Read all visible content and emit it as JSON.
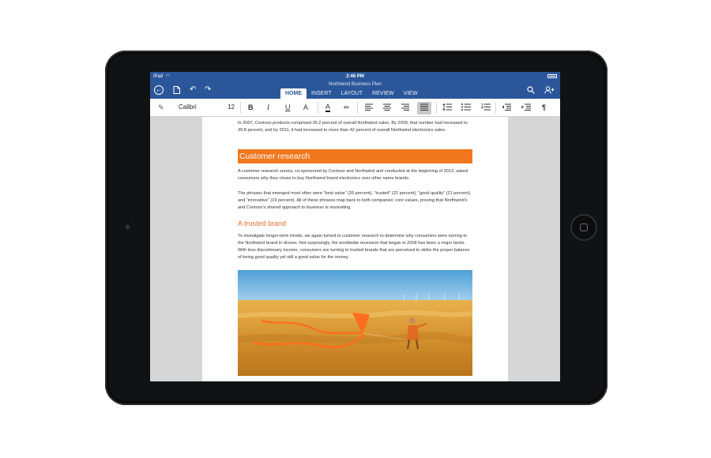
{
  "status_bar": {
    "carrier": "iPad",
    "time": "2:46 PM"
  },
  "title_bar": {
    "document_title": "Northwind Business Plan",
    "tabs": [
      {
        "label": "HOME",
        "active": true
      },
      {
        "label": "INSERT",
        "active": false
      },
      {
        "label": "LAYOUT",
        "active": false
      },
      {
        "label": "REVIEW",
        "active": false
      },
      {
        "label": "VIEW",
        "active": false
      }
    ],
    "icons": [
      "back-icon",
      "document-icon",
      "undo-icon",
      "redo-icon",
      "search-icon",
      "share-person-icon"
    ]
  },
  "toolbar": {
    "font_name": "Calibri",
    "font_size": "12",
    "bold_label": "B",
    "italic_label": "I",
    "underline_label": "U",
    "text_effects_label": "A",
    "font_color_label": "A",
    "paragraph_mark_label": "¶"
  },
  "document": {
    "para_intro": "In 2007, Contoso products comprised 35.2 percent of overall Northwind sales. By 2009, that number had increased to 39.8 percent, and by 2011, it had increased to more than 42 percent of overall Northwind electronics sales.",
    "heading_research": "Customer research",
    "para_survey": "A customer research survey, co-sponsored by Contoso and Northwind and conducted at the beginning of 2013, asked consumers why they chose to buy Northwind brand electronics over other name brands.",
    "para_phrases": "The phrases that emerged most often were “best value” (26 percent), “trusted” (22 percent), “good quality” (21 percent), and “innovative” (19 percent). All of these phrases map back to both companies’ core values, proving that Northwind’s and Contoso’s shared approach to business is resonating.",
    "heading_trusted": "A trusted brand",
    "para_trends": "To investigate longer-term trends, we again turned to customer research to determine why consumers were turning to the Northwind brand in droves. Not surprisingly, the worldwide recession that began in 2008 has been a major factor. With less discretionary income, consumers are turning to trusted brands that are perceived to strike the proper balance of being good quality yet still a good value for the money."
  },
  "colors": {
    "word_blue": "#2b579a",
    "heading_orange": "#f0771e",
    "bezel": "#111214"
  }
}
